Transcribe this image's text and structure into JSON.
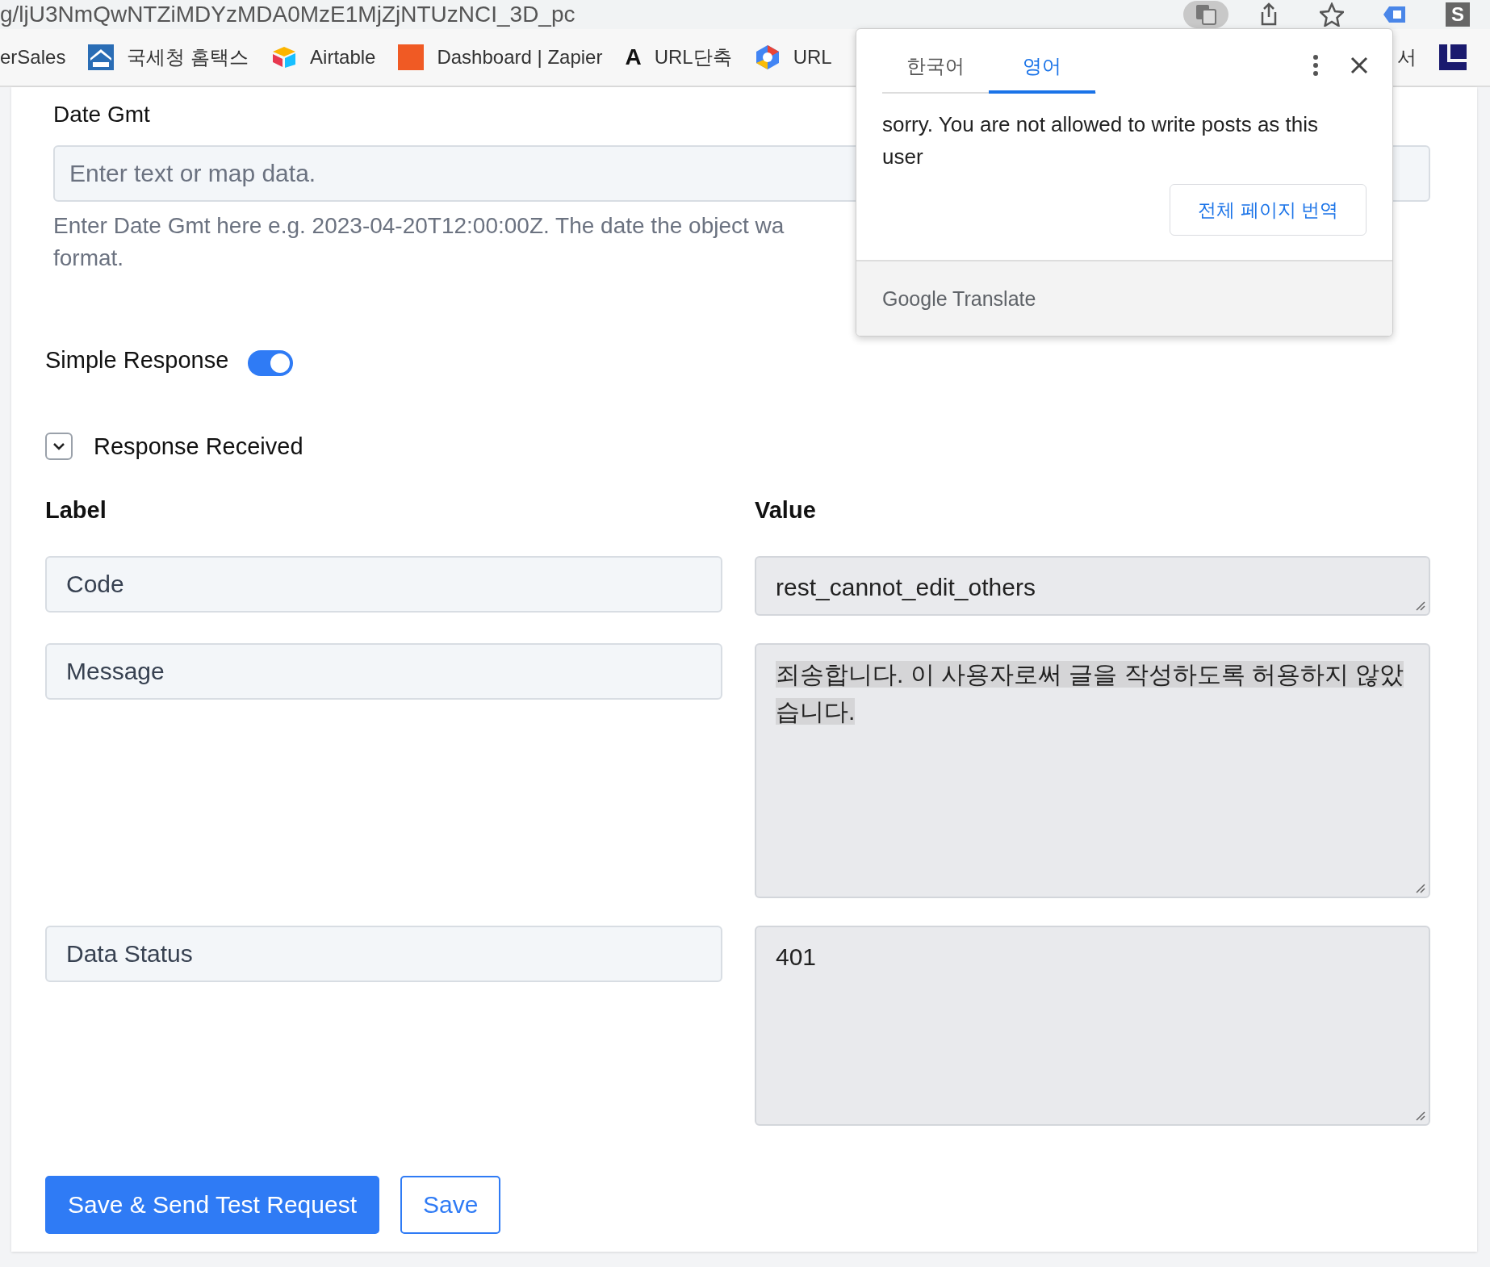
{
  "browser": {
    "url": "g/ljU3NmQwNTZiMDYzMDA0MzE1MjZjNTUzNCI_3D_pc",
    "toolbar_icons": [
      {
        "kind": "translate",
        "active": true
      },
      {
        "kind": "share",
        "active": false
      },
      {
        "kind": "star",
        "active": false
      },
      {
        "kind": "extension",
        "active": false
      },
      {
        "kind": "letter",
        "glyph": "S",
        "active": false
      }
    ]
  },
  "bookmarks": [
    {
      "kind": "none",
      "label": "erSales"
    },
    {
      "kind": "house",
      "label": "국세청 홈택스"
    },
    {
      "kind": "cube",
      "label": "Airtable"
    },
    {
      "kind": "square",
      "label": "Dashboard | Zapier"
    },
    {
      "kind": "letter",
      "glyph": "A",
      "label": "URL단축"
    },
    {
      "kind": "hexagon",
      "label": "URL"
    }
  ],
  "bookmarks_right": [
    {
      "kind": "none",
      "label": "서"
    },
    {
      "kind": "corner"
    }
  ],
  "date_field": {
    "label": "Date Gmt",
    "placeholder": "Enter text or map data.",
    "help_lines": [
      "Enter Date Gmt here e.g. 2023-04-20T12:00:00Z. The date the object wa",
      "format."
    ]
  },
  "simple_response": {
    "label": "Simple Response",
    "on": true
  },
  "response_section": {
    "label": "Response Received",
    "expanded": true
  },
  "columns": [
    "Label",
    "Value"
  ],
  "rows": [
    {
      "label": "Code",
      "value": "rest_cannot_edit_others",
      "selected": false
    },
    {
      "label": "Message",
      "value": "죄송합니다. 이 사용자로써 글을 작성하도록 허용하지 않았습니다.",
      "selected": true
    },
    {
      "label": "Data Status",
      "value": "401",
      "selected": false
    }
  ],
  "buttons": [
    {
      "label": "Save & Send Test Request",
      "kind": "primary"
    },
    {
      "label": "Save",
      "kind": "outline"
    }
  ],
  "translate_popup": {
    "tabs": [
      {
        "label": "한국어",
        "selected": false
      },
      {
        "label": "영어",
        "selected": true
      }
    ],
    "translation": "sorry. You are not allowed to write posts as this user",
    "button": "전체 페이지 번역",
    "footer": "Google Translate"
  }
}
